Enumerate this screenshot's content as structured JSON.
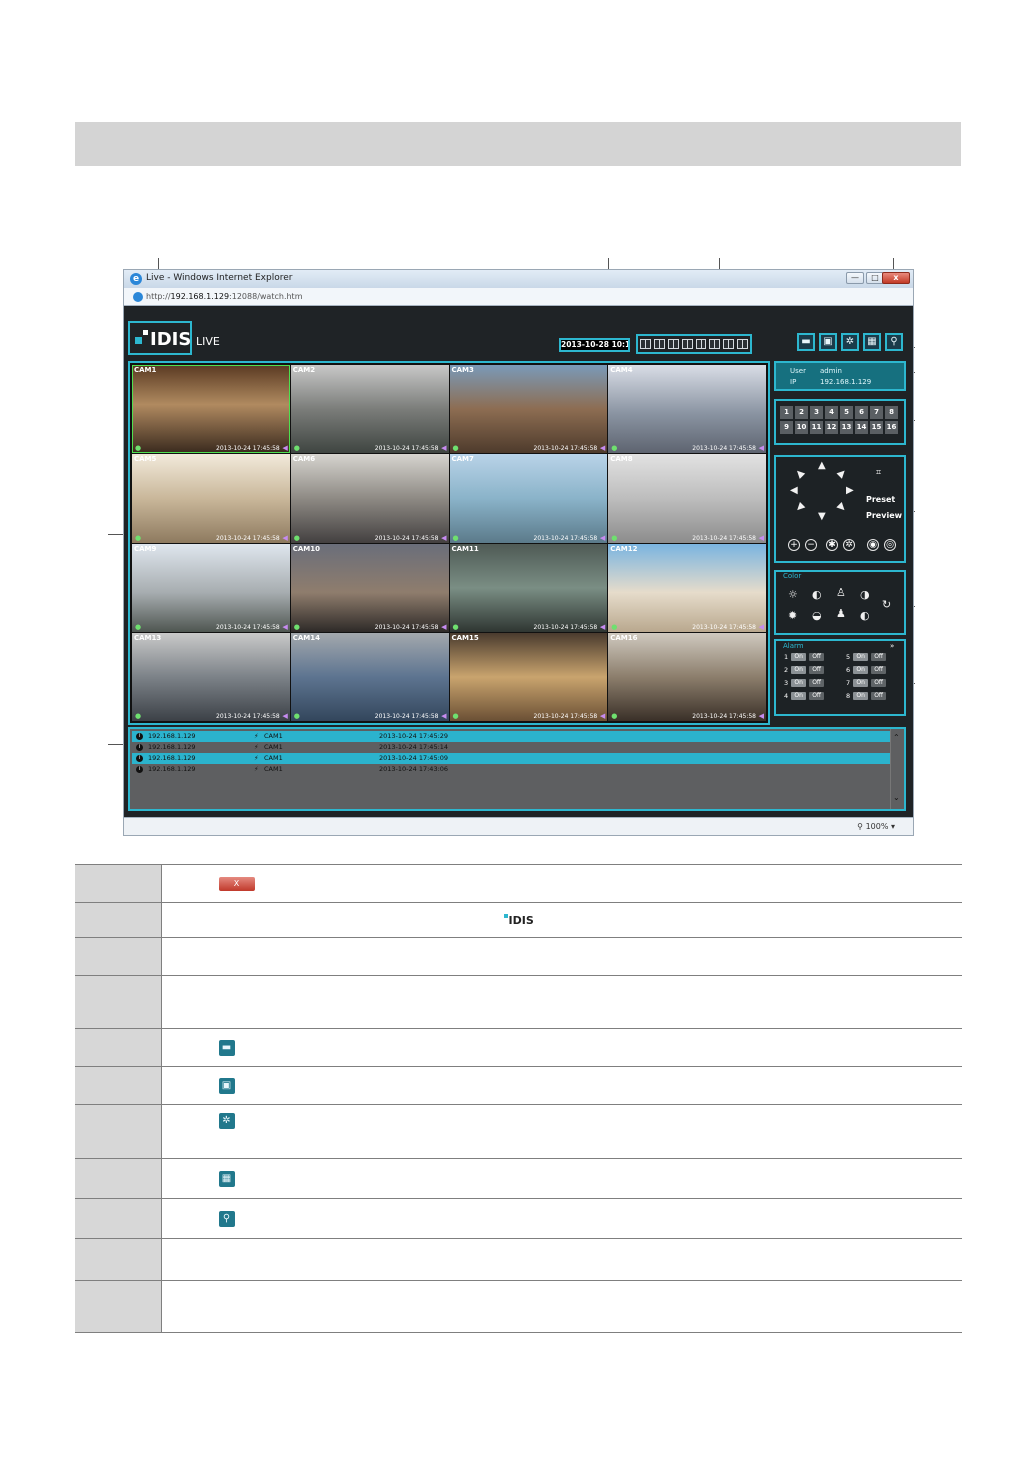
{
  "browser": {
    "title": "Live - Windows Internet Explorer",
    "url_prefix": "http://",
    "url_host": "192.168.1.129",
    "url_path": ":12088/watch.htm",
    "minimize_label": "—",
    "maximize_label": "□",
    "close_label": "x",
    "zoom": "100%"
  },
  "app": {
    "logo_text": "IDIS",
    "mode_label": "LIVE",
    "datetime": "2013-10-28 10:16:56",
    "toolbar_icons": [
      "print-icon",
      "snapshot-icon",
      "settings-icon",
      "playback-icon",
      "search-icon"
    ],
    "toolbar_glyphs": [
      "▬",
      "▣",
      "✲",
      "▦",
      "⚲"
    ]
  },
  "cameras": [
    {
      "label": "CAM1",
      "timestamp": "2013-10-24 17:45:58",
      "bg": "linear-gradient(#5a3a22,#b08a60 45%,#3a2a1e)"
    },
    {
      "label": "CAM2",
      "timestamp": "2013-10-24 17:45:58",
      "bg": "linear-gradient(#c8c8c8,#7b7d7a 50%,#3f4541)"
    },
    {
      "label": "CAM3",
      "timestamp": "2013-10-24 17:45:58",
      "bg": "linear-gradient(#7a9ab8,#8d6d52 50%,#4e3b2c)"
    },
    {
      "label": "CAM4",
      "timestamp": "2013-10-24 17:45:58",
      "bg": "linear-gradient(#d9dde6,#8a94a2 55%,#5e6470)"
    },
    {
      "label": "CAM5",
      "timestamp": "2013-10-24 17:45:58",
      "bg": "linear-gradient(#f2eadb,#c9b79a 50%,#8e7a5f)"
    },
    {
      "label": "CAM6",
      "timestamp": "2013-10-24 17:45:58",
      "bg": "linear-gradient(#d6d4cf,#8e8a84 50%,#434040)"
    },
    {
      "label": "CAM7",
      "timestamp": "2013-10-24 17:45:58",
      "bg": "linear-gradient(#b9d3e8,#8ab3c9 50%,#5b7a8a)"
    },
    {
      "label": "CAM8",
      "timestamp": "2013-10-24 17:45:58",
      "bg": "linear-gradient(#e2e2e2,#bdbdbd 50%,#8c8c8c)"
    },
    {
      "label": "CAM9",
      "timestamp": "2013-10-24 17:45:58",
      "bg": "linear-gradient(#dfe6ee,#a7adb0 55%,#4f5651)"
    },
    {
      "label": "CAM10",
      "timestamp": "2013-10-24 17:45:58",
      "bg": "linear-gradient(#6a6e7a,#8f7d6d 55%,#2e2a28)"
    },
    {
      "label": "CAM11",
      "timestamp": "2013-10-24 17:45:58",
      "bg": "linear-gradient(#4f5a55,#7a8e84 50%,#2f3632)"
    },
    {
      "label": "CAM12",
      "timestamp": "2013-10-24 17:45:58",
      "bg": "linear-gradient(#7ab4e0,#e6dccb 55%,#b9a88e)"
    },
    {
      "label": "CAM13",
      "timestamp": "2013-10-24 17:45:58",
      "bg": "linear-gradient(#c9c9c9,#7c8288 50%,#3c4147)"
    },
    {
      "label": "CAM14",
      "timestamp": "2013-10-24 17:45:58",
      "bg": "linear-gradient(#a3a8ad,#5d7490 50%,#33465c)"
    },
    {
      "label": "CAM15",
      "timestamp": "2013-10-24 17:45:58",
      "bg": "linear-gradient(#4a3b2e,#c9a46e 50%,#6b5035)"
    },
    {
      "label": "CAM16",
      "timestamp": "2013-10-24 17:45:58",
      "bg": "linear-gradient(#cfc9bf,#8c7e6c 50%,#3a3028)"
    }
  ],
  "user_panel": {
    "user_label": "User",
    "user_value": "admin",
    "ip_label": "IP",
    "ip_value": "192.168.1.129"
  },
  "camera_numbers": [
    "1",
    "2",
    "3",
    "4",
    "5",
    "6",
    "7",
    "8",
    "9",
    "10",
    "11",
    "12",
    "13",
    "14",
    "15",
    "16"
  ],
  "ptz": {
    "preset_label": "Preset",
    "preview_label": "Preview",
    "zoom_in": "+",
    "zoom_out": "−"
  },
  "color_panel": {
    "title": "Color",
    "icons_top": [
      "☼",
      "◐",
      "♙",
      "◑"
    ],
    "icons_bottom": [
      "✹",
      "◒",
      "♟",
      "◐"
    ],
    "reset": "↻"
  },
  "alarm": {
    "title": "Alarm",
    "on_label": "On",
    "off_label": "Off",
    "rows": [
      {
        "left": "1",
        "right": "5"
      },
      {
        "left": "2",
        "right": "6"
      },
      {
        "left": "3",
        "right": "7"
      },
      {
        "left": "4",
        "right": "8"
      }
    ]
  },
  "events": [
    {
      "ip": "192.168.1.129",
      "camera": "CAM1",
      "time": "2013-10-24 17:45:29"
    },
    {
      "ip": "192.168.1.129",
      "camera": "CAM1",
      "time": "2013-10-24 17:45:14"
    },
    {
      "ip": "192.168.1.129",
      "camera": "CAM1",
      "time": "2013-10-24 17:45:09"
    },
    {
      "ip": "192.168.1.129",
      "camera": "CAM1",
      "time": "2013-10-24 17:43:06"
    }
  ],
  "table": {
    "close_icon_label": "X",
    "logo_text": "IDIS",
    "row_icons": [
      "▬",
      "▣",
      "✲",
      "▦",
      "⚲"
    ]
  },
  "colors": {
    "accent": "#2db7cf",
    "header_gray": "#d4d4d4",
    "app_bg": "#1f2326"
  }
}
